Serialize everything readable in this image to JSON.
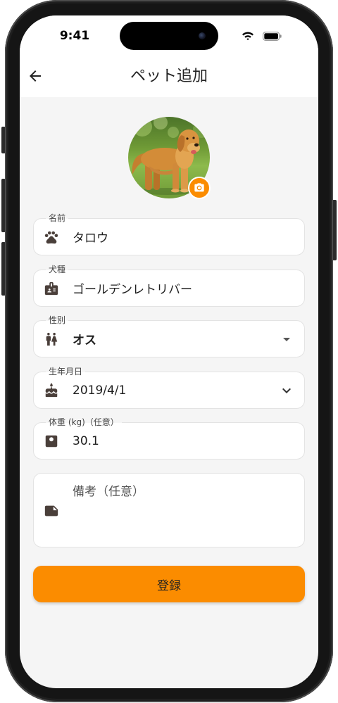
{
  "status_bar": {
    "time": "9:41",
    "icons": [
      "wifi-icon",
      "battery-icon"
    ]
  },
  "header": {
    "title": "ペット追加",
    "back_icon": "arrow-back-icon"
  },
  "avatar": {
    "badge_icon": "camera-icon"
  },
  "form": {
    "name": {
      "label": "名前",
      "value": "タロウ",
      "icon": "paw-icon"
    },
    "breed": {
      "label": "犬種",
      "value": "ゴールデンレトリバー",
      "icon": "badge-icon"
    },
    "sex": {
      "label": "性別",
      "value": "オス",
      "icon": "wc-icon",
      "trailing_icon": "dropdown-arrow-icon"
    },
    "birthdate": {
      "label": "生年月日",
      "value": "2019/4/1",
      "icon": "cake-icon",
      "trailing_icon": "chevron-down-icon"
    },
    "weight": {
      "label": "体重 (kg)（任意）",
      "value": "30.1",
      "icon": "scale-icon"
    },
    "notes": {
      "placeholder": "備考（任意）",
      "icon": "note-icon"
    }
  },
  "submit_button": {
    "label": "登録"
  },
  "colors": {
    "accent": "#FB8C00",
    "background": "#F5F5F5",
    "surface": "#FFFFFF",
    "icon": "#4A3F3A",
    "text": "#1F1F1F"
  }
}
